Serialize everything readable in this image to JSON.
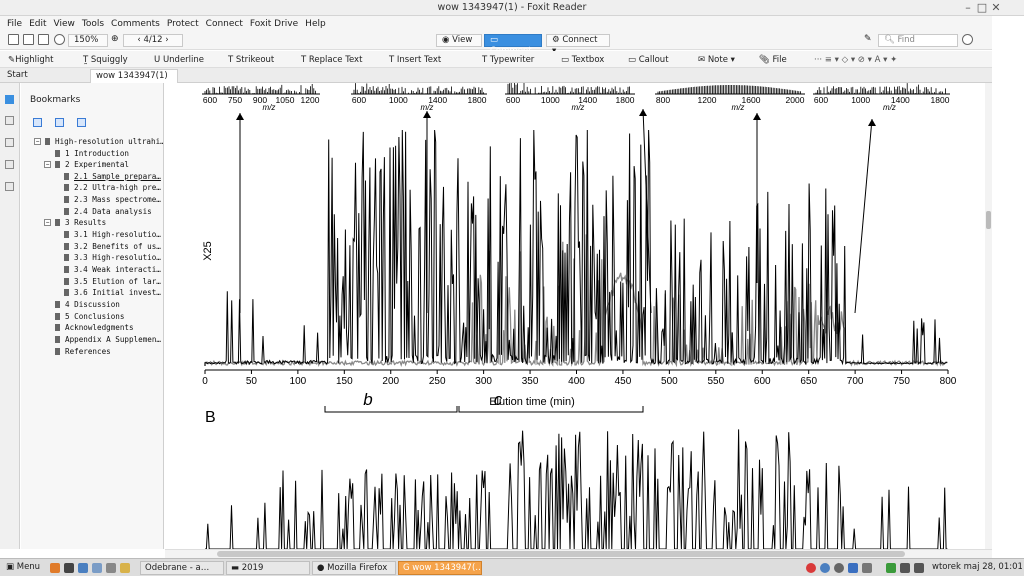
{
  "window": {
    "title": "wow 1343947(1) - Foxit Reader"
  },
  "menu": [
    "File",
    "Edit",
    "View",
    "Tools",
    "Comments",
    "Protect",
    "Connect",
    "Foxit Drive",
    "Help"
  ],
  "toolbar": {
    "zoom": "150%",
    "page": "4/12",
    "mode_view": "View",
    "mode_comment": "Comment",
    "mode_connect": "Connect",
    "find_placeholder": "Find"
  },
  "comment_tools": [
    "Highlight",
    "Squiggly",
    "Underline",
    "Strikeout",
    "Replace Text",
    "Insert Text",
    "Typewriter",
    "Textbox",
    "Callout",
    "Note",
    "File"
  ],
  "tabs": {
    "start": "Start",
    "doc": "wow 1343947(1)"
  },
  "bookmarks": {
    "header": "Bookmarks",
    "items": [
      {
        "label": "High-resolution ultrahi…"
      },
      {
        "label": "1 Introduction"
      },
      {
        "label": "2 Experimental"
      },
      {
        "label": "2.1 Sample prepara…"
      },
      {
        "label": "2.2 Ultra-high pre…"
      },
      {
        "label": "2.3 Mass spectrome…"
      },
      {
        "label": "2.4 Data analysis"
      },
      {
        "label": "3 Results"
      },
      {
        "label": "3.1 High-resolutio…"
      },
      {
        "label": "3.2 Benefits of us…"
      },
      {
        "label": "3.3 High-resolutio…"
      },
      {
        "label": "3.4 Weak interacti…"
      },
      {
        "label": "3.5 Elution of lar…"
      },
      {
        "label": "3.6 Initial invest…"
      },
      {
        "label": "4 Discussion"
      },
      {
        "label": "5 Conclusions"
      },
      {
        "label": "Acknowledgments"
      },
      {
        "label": "Appendix A Supplemen…"
      },
      {
        "label": "References"
      }
    ]
  },
  "figure": {
    "x25": "X25",
    "panel_b": "B",
    "bracket_b": "b",
    "bracket_c": "c",
    "xlabel": "Elution time (min)",
    "mz": "m/z",
    "inset_ticks": [
      [
        "600",
        "750",
        "900",
        "1050",
        "1200"
      ],
      [
        "600",
        "1000",
        "1400",
        "1800"
      ],
      [
        "600",
        "1000",
        "1400",
        "1800"
      ],
      [
        "800",
        "1200",
        "1600",
        "2000"
      ],
      [
        "600",
        "1000",
        "1400",
        "1800"
      ]
    ]
  },
  "chart_data": {
    "type": "line",
    "xlabel": "Elution time (min)",
    "x_ticks": [
      0,
      50,
      100,
      150,
      200,
      250,
      300,
      350,
      400,
      450,
      500,
      550,
      600,
      650,
      700,
      750,
      800
    ],
    "xlim": [
      0,
      800
    ]
  },
  "taskbar": {
    "menu": "Menu",
    "items": [
      "Odebrane - a…",
      "2019",
      "Mozilla Firefox",
      "wow 1343947(…"
    ],
    "clock": "wtorek maj 28, 01:01"
  },
  "colors": {
    "accent": "#3a8fe0",
    "active_task": "#f5a34b"
  }
}
